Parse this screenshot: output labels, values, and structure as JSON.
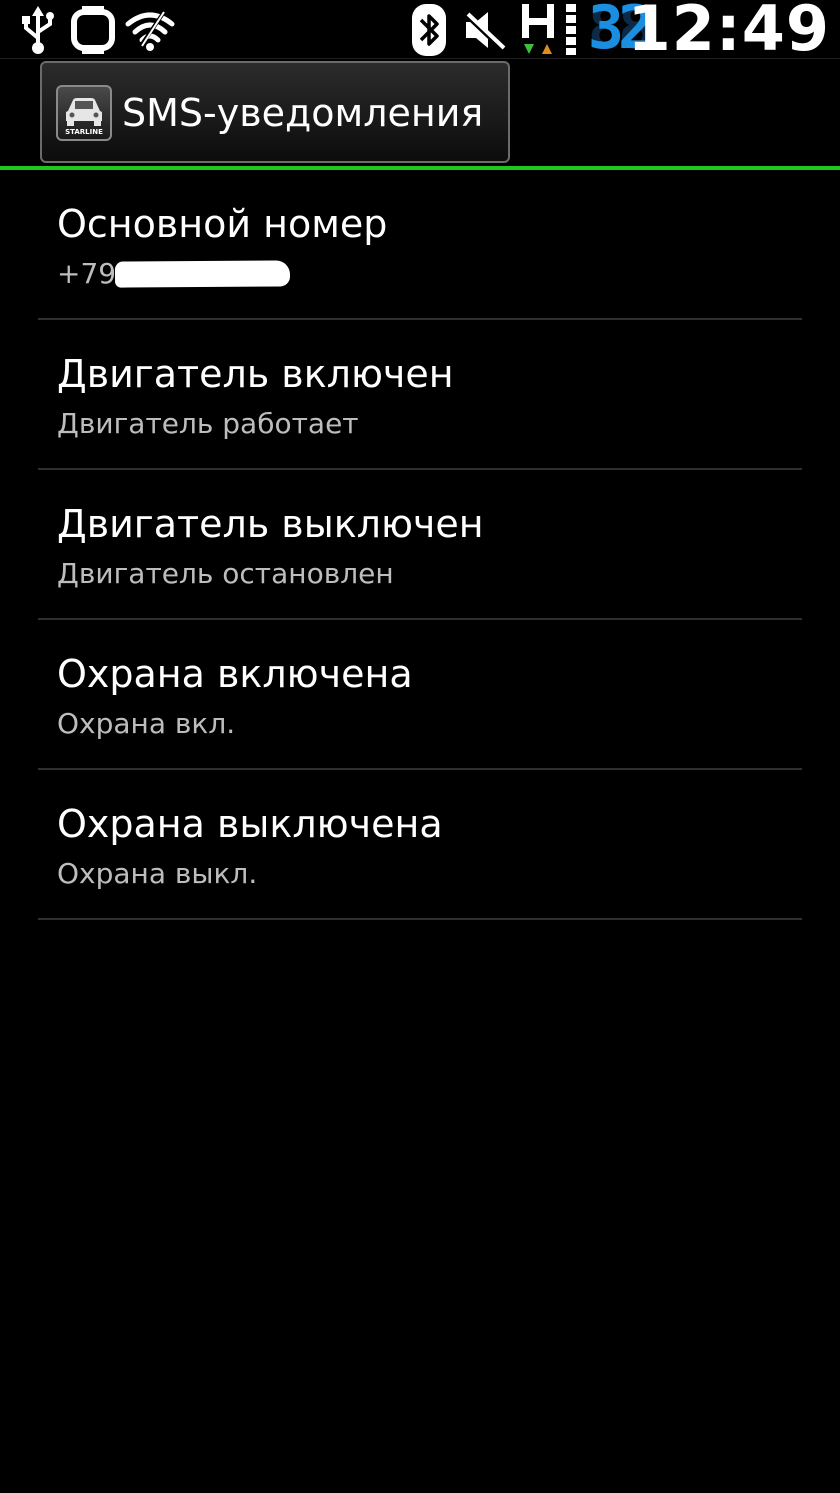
{
  "status_bar": {
    "time": "12:49",
    "battery_level": "32",
    "network_type": "H",
    "icons": [
      "usb-icon",
      "watch-icon",
      "wifi-icon",
      "bluetooth-icon",
      "mute-icon",
      "network-h-icon",
      "signal-bars-icon"
    ],
    "colors": {
      "battery_digits": "#1b8ee0",
      "data_down": "#3fbf3f",
      "data_up": "#e08c1e"
    }
  },
  "action_bar": {
    "title": "SMS-уведомления",
    "app_icon_brand": "STARLINE",
    "accent_color": "#1ec61e"
  },
  "preferences": [
    {
      "title": "Основной номер",
      "summary": "+79"
    },
    {
      "title": "Двигатель включен",
      "summary": "Двигатель работает"
    },
    {
      "title": "Двигатель выключен",
      "summary": "Двигатель остановлен"
    },
    {
      "title": "Охрана включена",
      "summary": "Охрана вкл."
    },
    {
      "title": "Охрана выключена",
      "summary": "Охрана выкл."
    }
  ]
}
